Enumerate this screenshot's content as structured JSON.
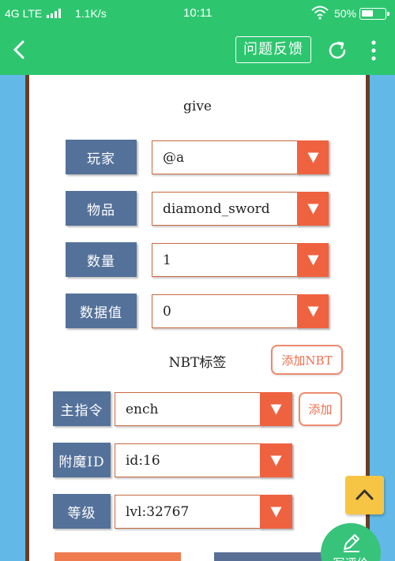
{
  "status_bar": {
    "network": "4G LTE",
    "speed": "1.1K/s",
    "time": "10:11",
    "battery": "50%"
  },
  "header": {
    "feedback_label": "问题反馈",
    "icons": [
      "back-icon",
      "refresh-icon",
      "more-icon"
    ]
  },
  "command": {
    "name": "give"
  },
  "fields": [
    {
      "label": "玩家",
      "value": "@a"
    },
    {
      "label": "物品",
      "value": "diamond_sword"
    },
    {
      "label": "数量",
      "value": "1"
    },
    {
      "label": "数据值",
      "value": "0"
    }
  ],
  "nbt": {
    "label": "NBT标签",
    "add_nbt_button": "添加NBT"
  },
  "nbt_fields": [
    {
      "label": "主指令",
      "value": "ench"
    },
    {
      "label": "附魔ID",
      "value": "id:16"
    },
    {
      "label": "等级",
      "value": "lvl:32767"
    }
  ],
  "add_button": "添加",
  "floating": {
    "review_label": "写评价"
  },
  "colors": {
    "header_green": "#2dc66f",
    "label_blue": "#54719a",
    "dropdown_orange": "#ef6240",
    "page_blue": "#62b9e8",
    "scroll_top_yellow": "#f6c544"
  }
}
